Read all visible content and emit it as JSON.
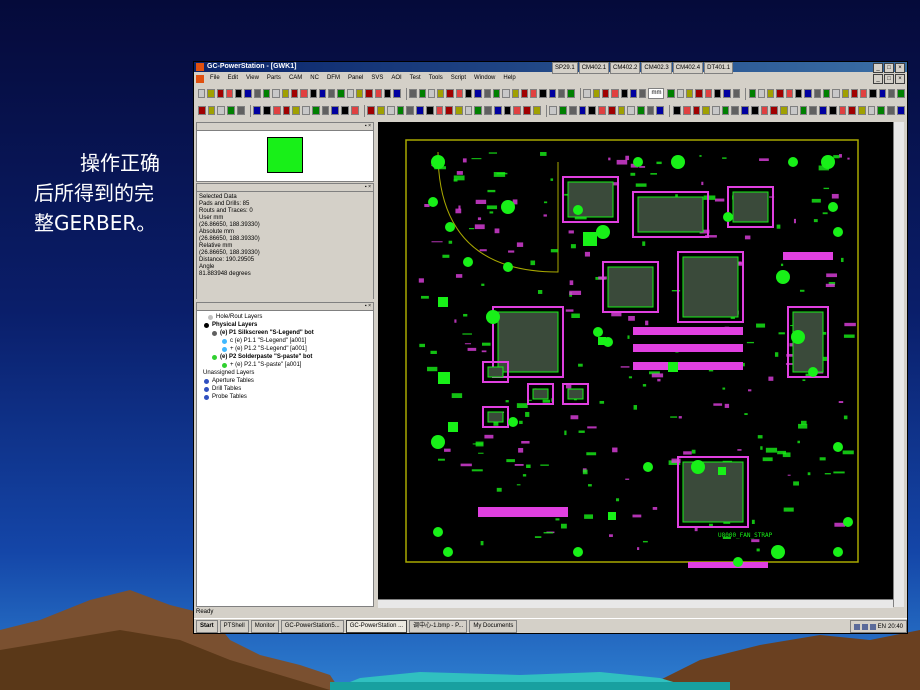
{
  "caption": {
    "text": "操作正确后所得到的完整GERBER。"
  },
  "window": {
    "title": "GC-PowerStation - [GWK1]",
    "control_boxes": [
      "SP29.1",
      "CM402.1",
      "CM402.2",
      "CM402.3",
      "CM402.4",
      "DT401.1"
    ],
    "menu": [
      "File",
      "Edit",
      "View",
      "Parts",
      "CAM",
      "NC",
      "DFM",
      "Panel",
      "SVS",
      "AOI",
      "Test",
      "Tools",
      "Script",
      "Window",
      "Help"
    ],
    "units_select": "mm"
  },
  "info_panel": {
    "lines": [
      "Selected Data",
      "Pads and Drills: 85",
      "Routs and Traces: 0",
      "User mm",
      "(26.86650, 188.39330)",
      "Absolute mm",
      "(26.86650, 188.39330)",
      "Relative mm",
      "(26.86650, 188.39330)",
      "Distance: 190.29505",
      "Angle",
      "81.883948 degrees"
    ]
  },
  "layer_tree": {
    "items": [
      {
        "label": "Hole/Rout Layers"
      },
      {
        "label": "Physical Layers"
      },
      {
        "label": "(e) P1 Silkscreen \"S-Legend\" bot"
      },
      {
        "label": "c (e) P1.1 \"S-Legend\" [a001]"
      },
      {
        "label": "+ (e) P1.2 \"S-Legend\" [a001]"
      },
      {
        "label": "(e) P2 Solderpaste \"S-paste\" bot"
      },
      {
        "label": "+ (e) P2.1 \"S-paste\" [a001]"
      },
      {
        "label": "Unassigned Layers"
      },
      {
        "label": "Aperture Tables"
      },
      {
        "label": "Drill Tables"
      },
      {
        "label": "Probe Tables"
      }
    ]
  },
  "board": {
    "silk_text": "U8000_FAN_STRAP"
  },
  "status": {
    "text": "Ready"
  },
  "taskbar": {
    "tasks": [
      "Start",
      "PTShell",
      "Monitor",
      "GC-PowerStation5...",
      "GC-PowerStation ...",
      "调中心-1.bmp - P...",
      "My Documents"
    ],
    "lang": "EN",
    "clock": "20:40"
  },
  "colors": {
    "copper": "#18f018",
    "silk": "#e040e0",
    "outline": "#a8a800",
    "mask": "#20a0c0"
  }
}
